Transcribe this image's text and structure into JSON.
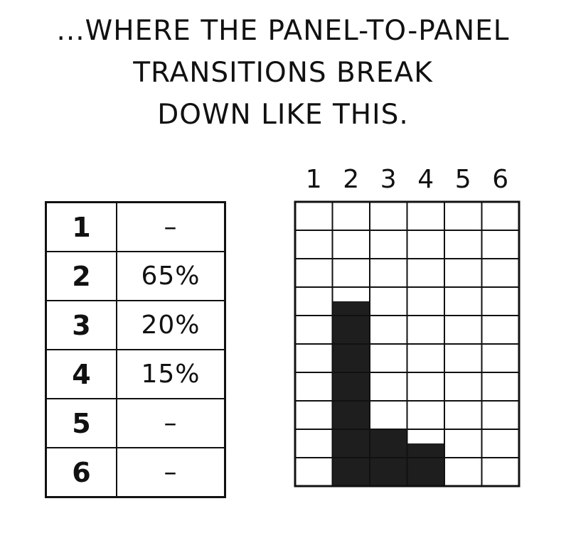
{
  "caption": {
    "lines": [
      "...WHERE THE PANEL-TO-PANEL",
      "TRANSITIONS BREAK",
      "DOWN LIKE THIS."
    ]
  },
  "table": {
    "rows": [
      {
        "category": "1",
        "value": "–"
      },
      {
        "category": "2",
        "value": "65%"
      },
      {
        "category": "3",
        "value": "20%"
      },
      {
        "category": "4",
        "value": "15%"
      },
      {
        "category": "5",
        "value": "–"
      },
      {
        "category": "6",
        "value": "–"
      }
    ]
  },
  "chart_data": {
    "type": "bar",
    "categories": [
      "1",
      "2",
      "3",
      "4",
      "5",
      "6"
    ],
    "values": [
      0,
      65,
      20,
      15,
      0,
      0
    ],
    "title": "",
    "xlabel": "",
    "ylabel": "",
    "ylim": [
      0,
      100
    ],
    "grid": true,
    "x_axis_position": "top",
    "bar_color": "#1e1e1e",
    "grid_color": "#111111"
  }
}
